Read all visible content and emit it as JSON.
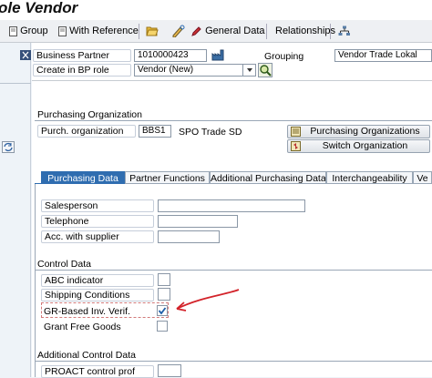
{
  "window": {
    "title": "ole Vendor"
  },
  "toolbar": {
    "group_label": "Group",
    "with_reference_label": "With Reference",
    "general_data_label": "General Data",
    "relationships_label": "Relationships"
  },
  "header": {
    "business_partner_label": "Business Partner",
    "business_partner_value": "1010000423",
    "grouping_label": "Grouping",
    "grouping_value": "Vendor Trade Lokal",
    "bp_role_label": "Create in BP role",
    "bp_role_value": "Vendor (New)"
  },
  "purch_org": {
    "section_title": "Purchasing Organization",
    "field_label": "Purch. organization",
    "code": "BBS1",
    "name": "SPO Trade SD",
    "btn_orgs": "Purchasing Organizations",
    "btn_switch": "Switch Organization"
  },
  "tabs": [
    "Purchasing Data",
    "Partner Functions",
    "Additional Purchasing Data",
    "Interchangeability",
    "Ve"
  ],
  "purchasing_fields": {
    "salesperson": "Salesperson",
    "telephone": "Telephone",
    "acc_supplier": "Acc. with supplier"
  },
  "control_data": {
    "section_title": "Control Data",
    "abc_indicator": "ABC indicator",
    "shipping_conditions": "Shipping Conditions",
    "gr_based": "GR-Based Inv. Verif.",
    "gr_based_checked": true,
    "grant_free_goods": "Grant Free Goods"
  },
  "additional_control": {
    "section_title": "Additional Control Data",
    "proact_label": "PROACT control prof"
  },
  "colors": {
    "annotation_arrow": "#d3232a",
    "active_tab": "#2f6db0",
    "checkmark": "#1f5fa8"
  }
}
